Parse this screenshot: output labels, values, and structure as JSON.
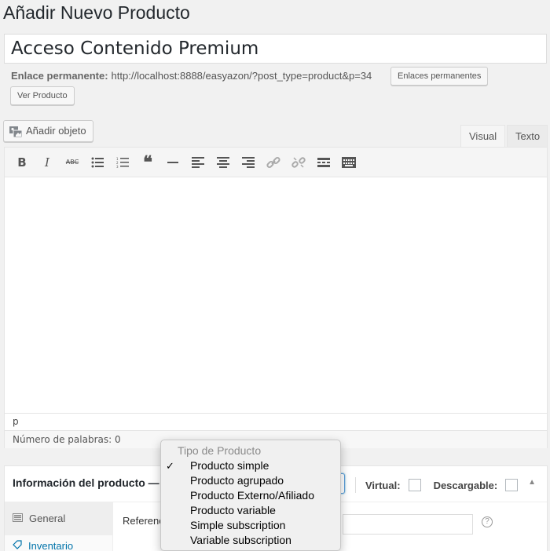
{
  "page": {
    "title": "Añadir Nuevo Producto"
  },
  "post_title": {
    "value": "Acceso Contenido Premium"
  },
  "permalink": {
    "label": "Enlace permanente:",
    "url": "http://localhost:8888/easyazon/?post_type=product&p=34",
    "permalinks_button": "Enlaces permanentes",
    "view_button": "Ver Producto"
  },
  "editor": {
    "add_media_label": "Añadir objeto",
    "tabs": [
      "Visual",
      "Texto"
    ],
    "active_tab": "Visual",
    "toolbar_icons": [
      "bold-icon",
      "italic-icon",
      "strikethrough-icon",
      "bullet-list-icon",
      "numbered-list-icon",
      "blockquote-icon",
      "horizontal-rule-icon",
      "align-left-icon",
      "align-center-icon",
      "align-right-icon",
      "link-icon",
      "unlink-icon",
      "read-more-icon",
      "toolbar-toggle-icon"
    ],
    "toolbar_glyphs": {
      "bold": "B",
      "italic": "I",
      "strike": "ABC",
      "bullet": "≡",
      "numbered": "≡",
      "quote": "❝",
      "hr": "—",
      "align_left": "≡",
      "align_center": "≡",
      "align_right": "≡",
      "link": "🔗",
      "unlink": "✂",
      "more": "▬",
      "kitchen": "▦"
    },
    "path": "p",
    "word_count": "Número de palabras: 0"
  },
  "product_data": {
    "title": "Información del producto —",
    "virtual_label": "Virtual:",
    "downloadable_label": "Descargable:",
    "sidebar": [
      {
        "label": "General",
        "icon": "general-icon"
      },
      {
        "label": "Inventario",
        "icon": "inventory-icon"
      }
    ],
    "sku_label": "Referenc",
    "help": "?",
    "toggle": "▲"
  },
  "product_type_dropdown": {
    "header": "Tipo de Producto",
    "check": "✓",
    "selected": "Producto simple",
    "options": [
      "Producto simple",
      "Producto agrupado",
      "Producto Externo/Afiliado",
      "Producto variable",
      "Simple subscription",
      "Variable subscription"
    ]
  },
  "colors": {
    "background": "#f1f1f1",
    "link": "#0073aa",
    "focus": "#5b9dd9"
  }
}
